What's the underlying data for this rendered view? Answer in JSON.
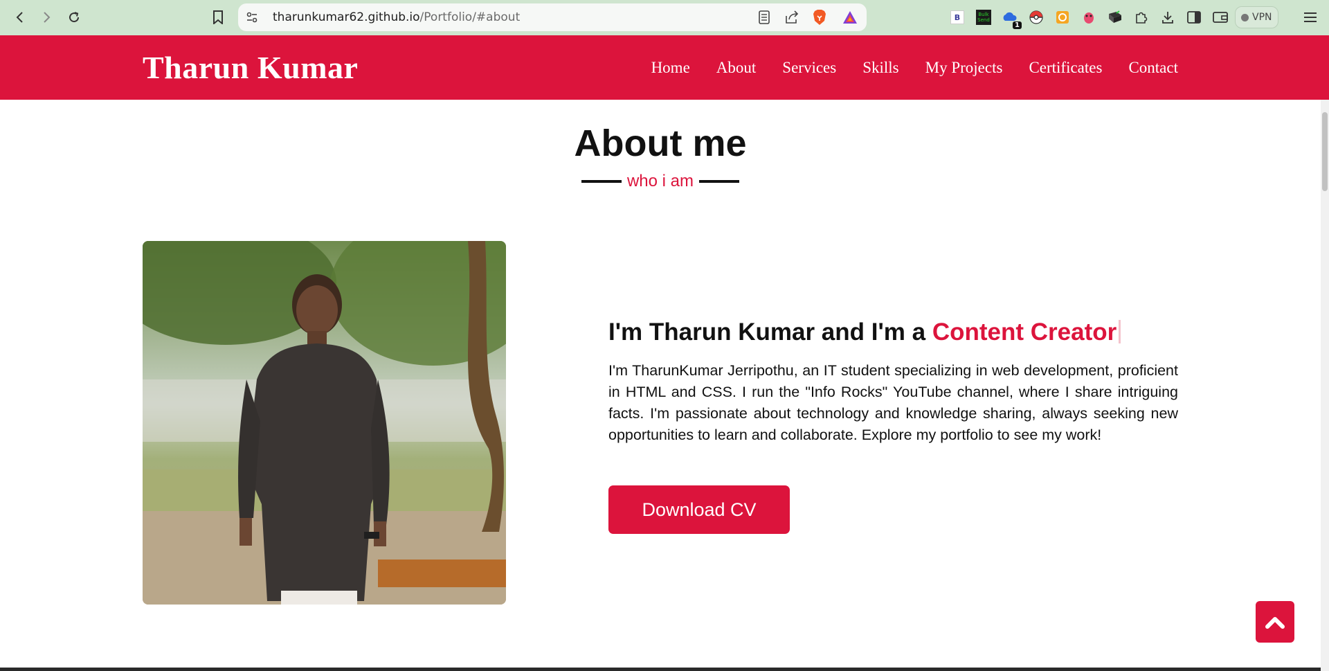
{
  "browser": {
    "url_host": "tharunkumar62.github.io",
    "url_path": "/Portfolio/#about",
    "extensions": [
      "b-extension-icon",
      "bulk-send-extension-icon",
      "cloud-extension-icon",
      "pokeball-extension-icon",
      "orange-extension-icon",
      "bug-extension-icon",
      "pc-extension-icon",
      "puzzle-icon"
    ],
    "badge_count": "1",
    "vpn_label": "VPN",
    "b_label": "B",
    "bulk_send_label": "Bulk Send"
  },
  "site": {
    "brand": "Tharun Kumar",
    "nav": [
      "Home",
      "About",
      "Services",
      "Skills",
      "My Projects",
      "Certificates",
      "Contact"
    ]
  },
  "about": {
    "title": "About me",
    "subtitle": "who i am",
    "headline_prefix": "I'm Tharun Kumar and I'm a ",
    "headline_accent": "Content Creator",
    "paragraph": "I'm TharunKumar Jerripothu, an IT student specializing in web development, proficient in HTML and CSS. I run the \"Info Rocks\" YouTube channel, where I share intriguing facts. I'm passionate about technology and knowledge sharing, always seeking new opportunities to learn and collaborate. Explore my portfolio to see my work!",
    "cv_button": "Download CV"
  },
  "colors": {
    "accent": "#dc143c",
    "chrome": "#cfe5cf"
  }
}
